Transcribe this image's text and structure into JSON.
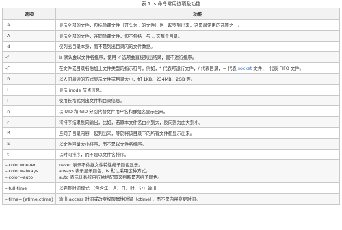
{
  "caption": "表 1 ls 命令常用选项及功能",
  "headers": {
    "option": "选项",
    "function": "功能"
  },
  "rows": [
    {
      "option": "-a",
      "desc": "显示全部的文件，包括隐藏文件（开头为 . 的文件）也一起罗列出来，这是最常用的选项之一。"
    },
    {
      "option": "-A",
      "desc": "显示全部的文件，连同隐藏文件，但不包括 . 与 .. 这两个目录。"
    },
    {
      "option": "-d",
      "desc": "仅列出目录本身，而不是列出目录内的文件数据。"
    },
    {
      "option": "-f",
      "desc": "ls 默认会以文件名排序，使用 -f 选项会直接列出结果，而不进行排序。"
    },
    {
      "option": "-F",
      "desc_pre": "在文件或目录名后加上文件类型的指示符号，例如，* 代表可运行文件，/ 代表目录，= 代表 ",
      "desc_hl": "socket",
      "desc_post": " 文件，| 代表 FIFO 文件。"
    },
    {
      "option": "-h",
      "desc": "以人们易读的方式显示文件或目录大小，如 1KB、234MB、2GB 等。"
    },
    {
      "option": "-i",
      "desc": "显示 inode 节点信息。"
    },
    {
      "option": "-l",
      "desc": "使用长格式列出文件和目录信息。"
    },
    {
      "option": "-n",
      "desc": "以 UID 和 GID 分别代替文件用户名和群组名显示出来。"
    },
    {
      "option": "-r",
      "desc": "将排序结果反向输出，比如，若原本文件名由小到大，反向则为由大到小。"
    },
    {
      "option": "-R",
      "desc": "连同子目录内容一起列出来，等於将该目录下的所有文件都显示出来。"
    },
    {
      "option": "-S",
      "desc": "以文件容量大小排序，而不是以文件名排序。"
    },
    {
      "option": "-t",
      "desc": "以时间排序，而不是以文件名排序。"
    }
  ],
  "color_row": {
    "options": [
      "--color=never",
      "--color=always",
      "--color=auto"
    ],
    "descs": [
      "never 表示不依据文件特性给予颜色显示。",
      "always 表示显示颜色，ls 默认采用这种方式。",
      "auto 表示让系统自行依据配置来判断是否给予颜色。"
    ]
  },
  "tail_rows": [
    {
      "option": "--full-time",
      "desc": "以完整时间模式 （包含年、月、日、时、分）输出"
    },
    {
      "option": "--time={atime,ctime}",
      "desc": "输出 access 时间或改变权限属性时间（ctime），而不是内容变更时间。"
    }
  ]
}
